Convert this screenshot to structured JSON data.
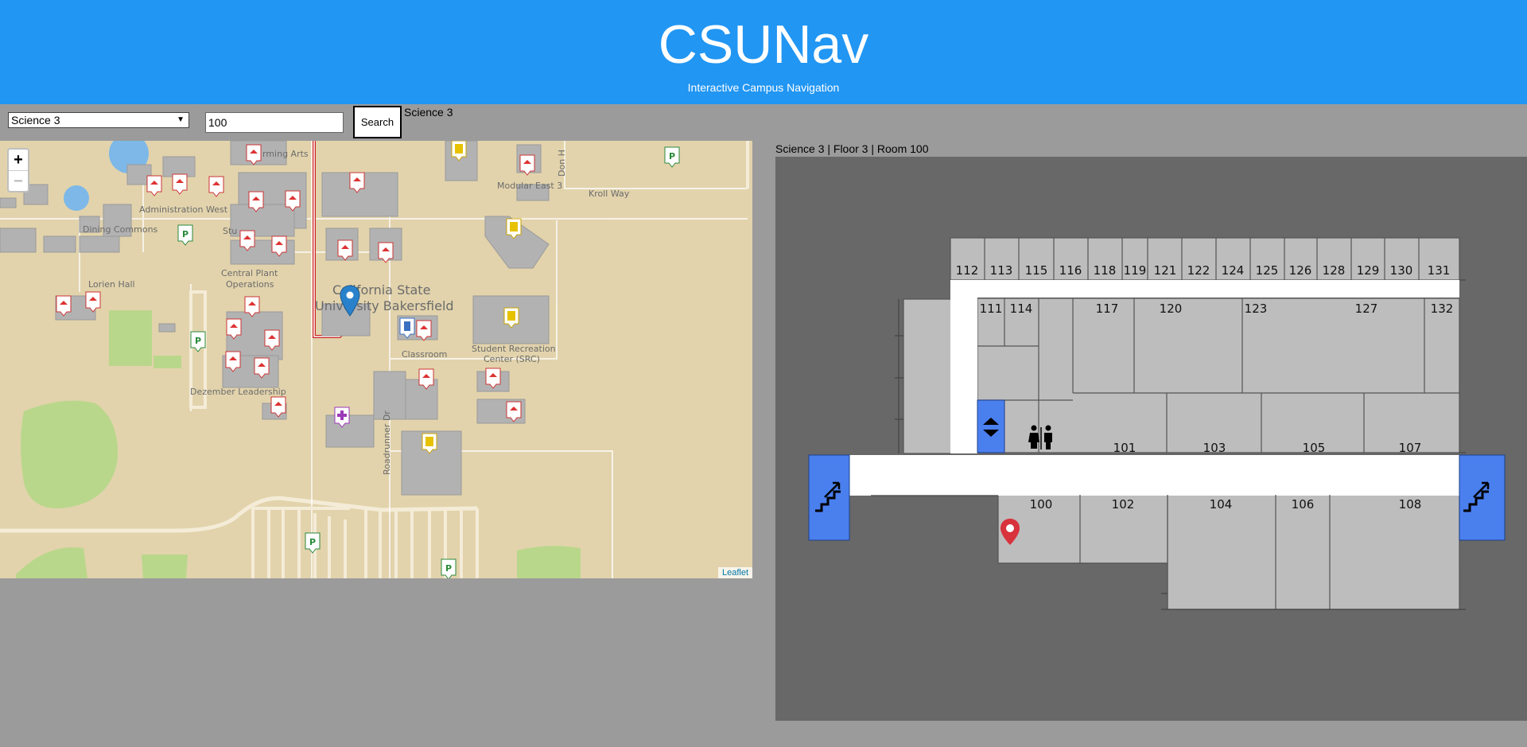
{
  "header": {
    "title": "CSUNav",
    "subtitle": "Interactive Campus Navigation"
  },
  "search": {
    "building_selected": "Science 3",
    "room_value": "100",
    "button_label": "Search",
    "selected_label": "Science 3"
  },
  "map": {
    "zoom_in": "+",
    "zoom_out": "−",
    "attribution": "Leaflet",
    "labels": {
      "performing_arts": "rming Arts",
      "modular_east": "Modular East 3",
      "don_hart": "Don H",
      "kroll_way": "Kroll Way",
      "admin_west": "Administration West",
      "dining": "Dining Commons",
      "student": "Stu",
      "lorien": "Lorien Hall",
      "central_plant": "Central Plant",
      "operations": "Operations",
      "csub_1": "California State",
      "csub_2": "University Bakersfield",
      "classroom": "Classroom",
      "src_1": "Student Recreation",
      "src_2": "Center (SRC)",
      "dezember": "Dezember Leadership",
      "roadrunner": "Roadrunner Dr"
    }
  },
  "floorplan": {
    "caption": "Science 3 | Floor 3 | Room 100",
    "top_rooms": [
      "112",
      "113",
      "115",
      "116",
      "118",
      "119",
      "121",
      "122",
      "124",
      "125",
      "126",
      "128",
      "129",
      "130",
      "131"
    ],
    "upper_rooms": [
      "111",
      "114",
      "117",
      "120",
      "123",
      "127",
      "132"
    ],
    "middle_rooms": [
      "101",
      "103",
      "105",
      "107"
    ],
    "lower_rooms": [
      "100",
      "102",
      "104",
      "106",
      "108"
    ],
    "colors": {
      "room": "#bdbdbd",
      "hall": "#ffffff",
      "stair": "#4a7fee",
      "marker": "#d8323c"
    }
  }
}
